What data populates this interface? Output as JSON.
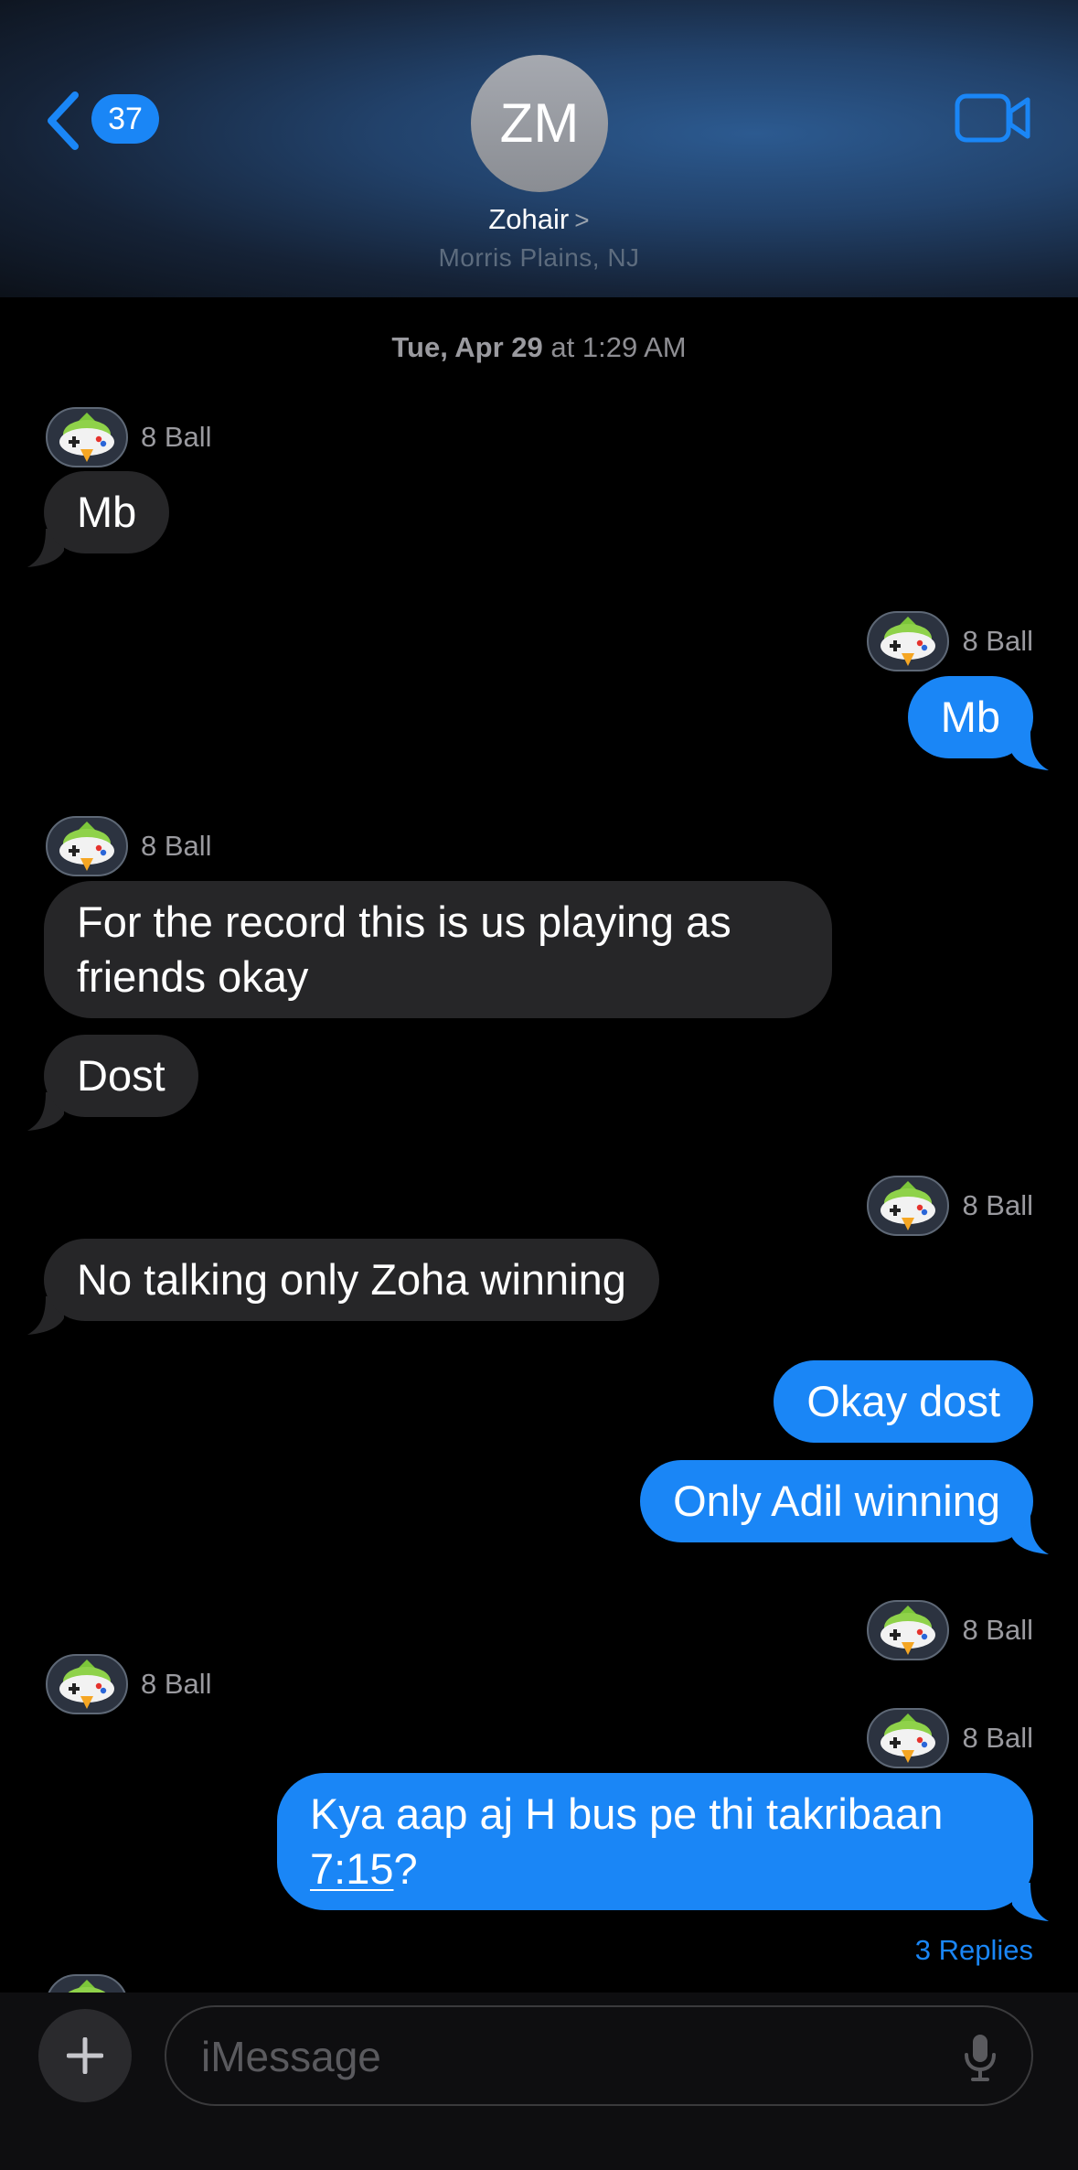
{
  "header": {
    "back_count": "37",
    "avatar_initials": "ZM",
    "contact_name": "Zohair",
    "contact_chevron": ">",
    "contact_location": "Morris Plains, NJ"
  },
  "timestamp": {
    "date": "Tue, Apr 29",
    "time": "at 1:29 AM"
  },
  "sender_label": "8 Ball",
  "messages": [
    {
      "text": "Mb"
    },
    {
      "text": "Mb"
    },
    {
      "text": "For the record this is us playing as friends okay"
    },
    {
      "text": "Dost"
    },
    {
      "text": "No talking only Zoha winning"
    },
    {
      "text": "Okay dost"
    },
    {
      "text": "Only Adil winning"
    },
    {
      "text_before": "Kya aap aj H bus pe thi takribaan",
      "link": "7:15",
      "text_after": "?"
    }
  ],
  "replies": "3 Replies",
  "compose": {
    "placeholder": "iMessage"
  },
  "icons": [
    "back-chevron-icon",
    "video-call-icon",
    "game-controller-icon",
    "plus-icon",
    "microphone-icon"
  ],
  "colors": {
    "accent": "#1a86f6",
    "incoming_bubble": "#262628",
    "background": "#000000"
  }
}
